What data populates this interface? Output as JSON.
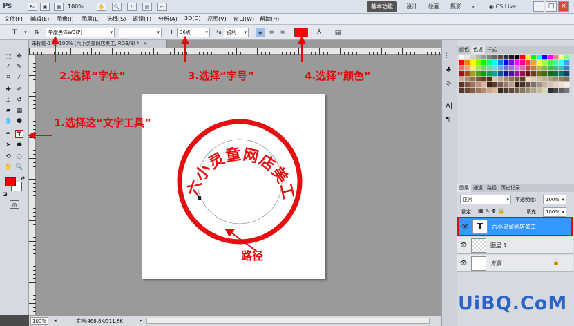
{
  "titlebar": {
    "app_logo": "Ps",
    "zoom": "100%",
    "workspaces": [
      "基本功能",
      "设计",
      "绘画",
      "摄影"
    ],
    "active_workspace": "基本功能",
    "cs_live": "CS Live",
    "window_buttons": [
      "–",
      "□",
      "×"
    ]
  },
  "menu": [
    "文件(F)",
    "编辑(E)",
    "图像(I)",
    "图层(L)",
    "选择(S)",
    "滤镜(T)",
    "分析(A)",
    "3D(D)",
    "视图(V)",
    "窗口(W)",
    "帮助(H)"
  ],
  "options": {
    "font_family": "华康黑体W9(P)",
    "font_style": "-",
    "font_size": "36点",
    "anti_alias": "锐利",
    "text_color": "#ff0000"
  },
  "document": {
    "tab_title": "未标题-1 @ 100% (六小灵童网店美工, RGB/8) *",
    "seal_text": "六小灵童网店美工",
    "zoom": "100%",
    "doc_info": "文档:468.8K/511.8K"
  },
  "annotations": {
    "step1": "1.选择这“文字工具”",
    "step2": "2.选择“字体”",
    "step3": "3.选择“字号”",
    "step4": "4.选择“颜色”",
    "path_label": "路径",
    "watermark": "UiBQ.CoM"
  },
  "swatch_panel": {
    "tabs": [
      "颜色",
      "色板",
      "样式"
    ],
    "active_tab": "色板"
  },
  "layers_panel": {
    "tabs": [
      "图层",
      "通道",
      "路径",
      "历史记录"
    ],
    "blend_mode": "正常",
    "opacity_label": "不透明度:",
    "opacity": "100%",
    "lock_label": "锁定:",
    "fill_label": "填充:",
    "fill": "100%",
    "layers": [
      {
        "name": "六小灵童网店美工",
        "type": "text",
        "selected": true
      },
      {
        "name": "图层 1",
        "type": "transparent",
        "selected": false
      },
      {
        "name": "背景",
        "type": "background",
        "selected": false
      }
    ]
  },
  "colors": {
    "foreground": "#ff0000",
    "background": "#ffffff",
    "accent": "#e10a0a",
    "selection": "#3399ff"
  }
}
